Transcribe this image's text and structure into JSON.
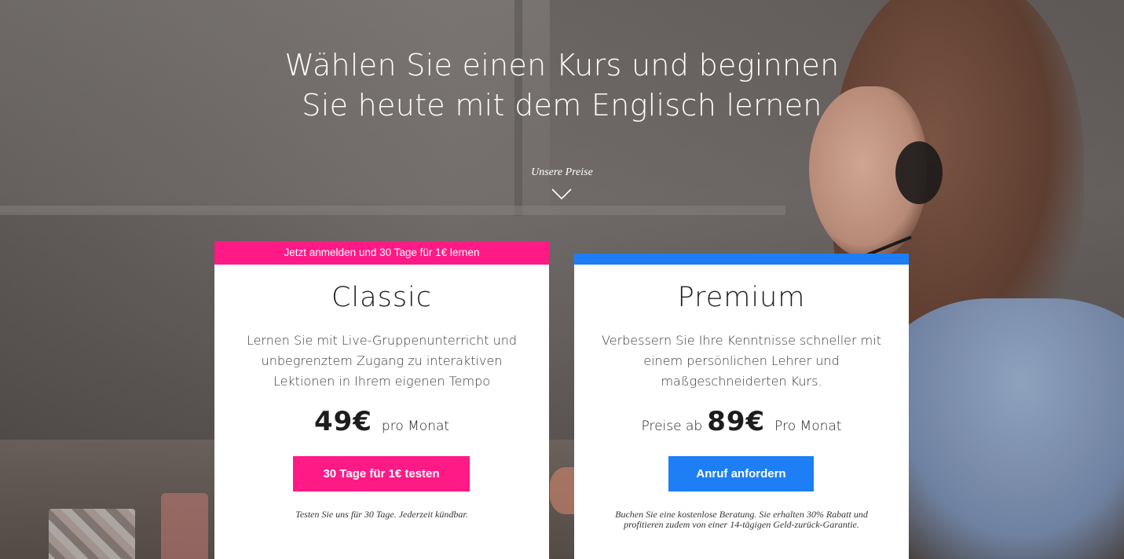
{
  "hero": {
    "title_line1": "Wählen Sie einen Kurs und beginnen",
    "title_line2": "Sie heute mit dem Englisch lernen",
    "prices_label": "Unsere Preise",
    "chevron_icon": "chevron-down-icon"
  },
  "colors": {
    "classic_accent": "#ff1a86",
    "premium_accent": "#1e7ef5"
  },
  "classic": {
    "banner": "Jetzt anmelden und 30 Tage für 1€ lernen",
    "title": "Classic",
    "description": "Lernen Sie mit Live-Gruppenunterricht und unbegrenztem Zugang zu interaktiven Lektionen in Ihrem eigenen Tempo",
    "price": "49€",
    "price_suffix": "pro Monat",
    "cta": "30 Tage für 1€ testen",
    "fineprint": "Testen Sie uns für 30 Tage. Jederzeit kündbar."
  },
  "premium": {
    "title": "Premium",
    "description": "Verbessern Sie Ihre Kenntnisse schneller mit einem persönlichen Lehrer und maßgeschneiderten Kurs.",
    "price_prefix": "Preise ab",
    "price": "89€",
    "price_suffix": "Pro Monat",
    "cta": "Anruf anfordern",
    "fineprint": "Buchen Sie eine kostenlose Beratung. Sie erhalten 30% Rabatt und profitieren zudem von einer 14-tägigen Geld-zurück-Garantie."
  }
}
